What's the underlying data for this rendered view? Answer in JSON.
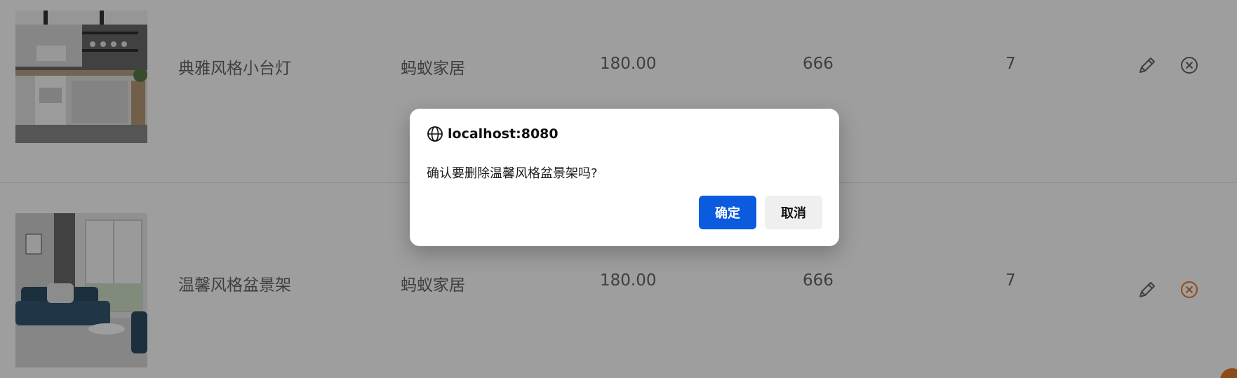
{
  "products": [
    {
      "name": "典雅风格小台灯",
      "brand": "蚂蚁家居",
      "price": "180.00",
      "sales": "666",
      "stock": "7",
      "image": "kitchen-photo"
    },
    {
      "name": "温馨风格盆景架",
      "brand": "蚂蚁家居",
      "price": "180.00",
      "sales": "666",
      "stock": "7",
      "image": "living-room-photo"
    }
  ],
  "icons": {
    "edit": "pencil-icon",
    "delete": "close-circle-icon",
    "site": "globe-icon"
  },
  "dialog": {
    "origin": "localhost:8080",
    "message": "确认要删除温馨风格盆景架吗?",
    "ok_label": "确定",
    "cancel_label": "取消"
  },
  "colors": {
    "primary_button": "#0b5bdf",
    "delete_active": "#e07a2a",
    "icon_default": "#666666"
  }
}
